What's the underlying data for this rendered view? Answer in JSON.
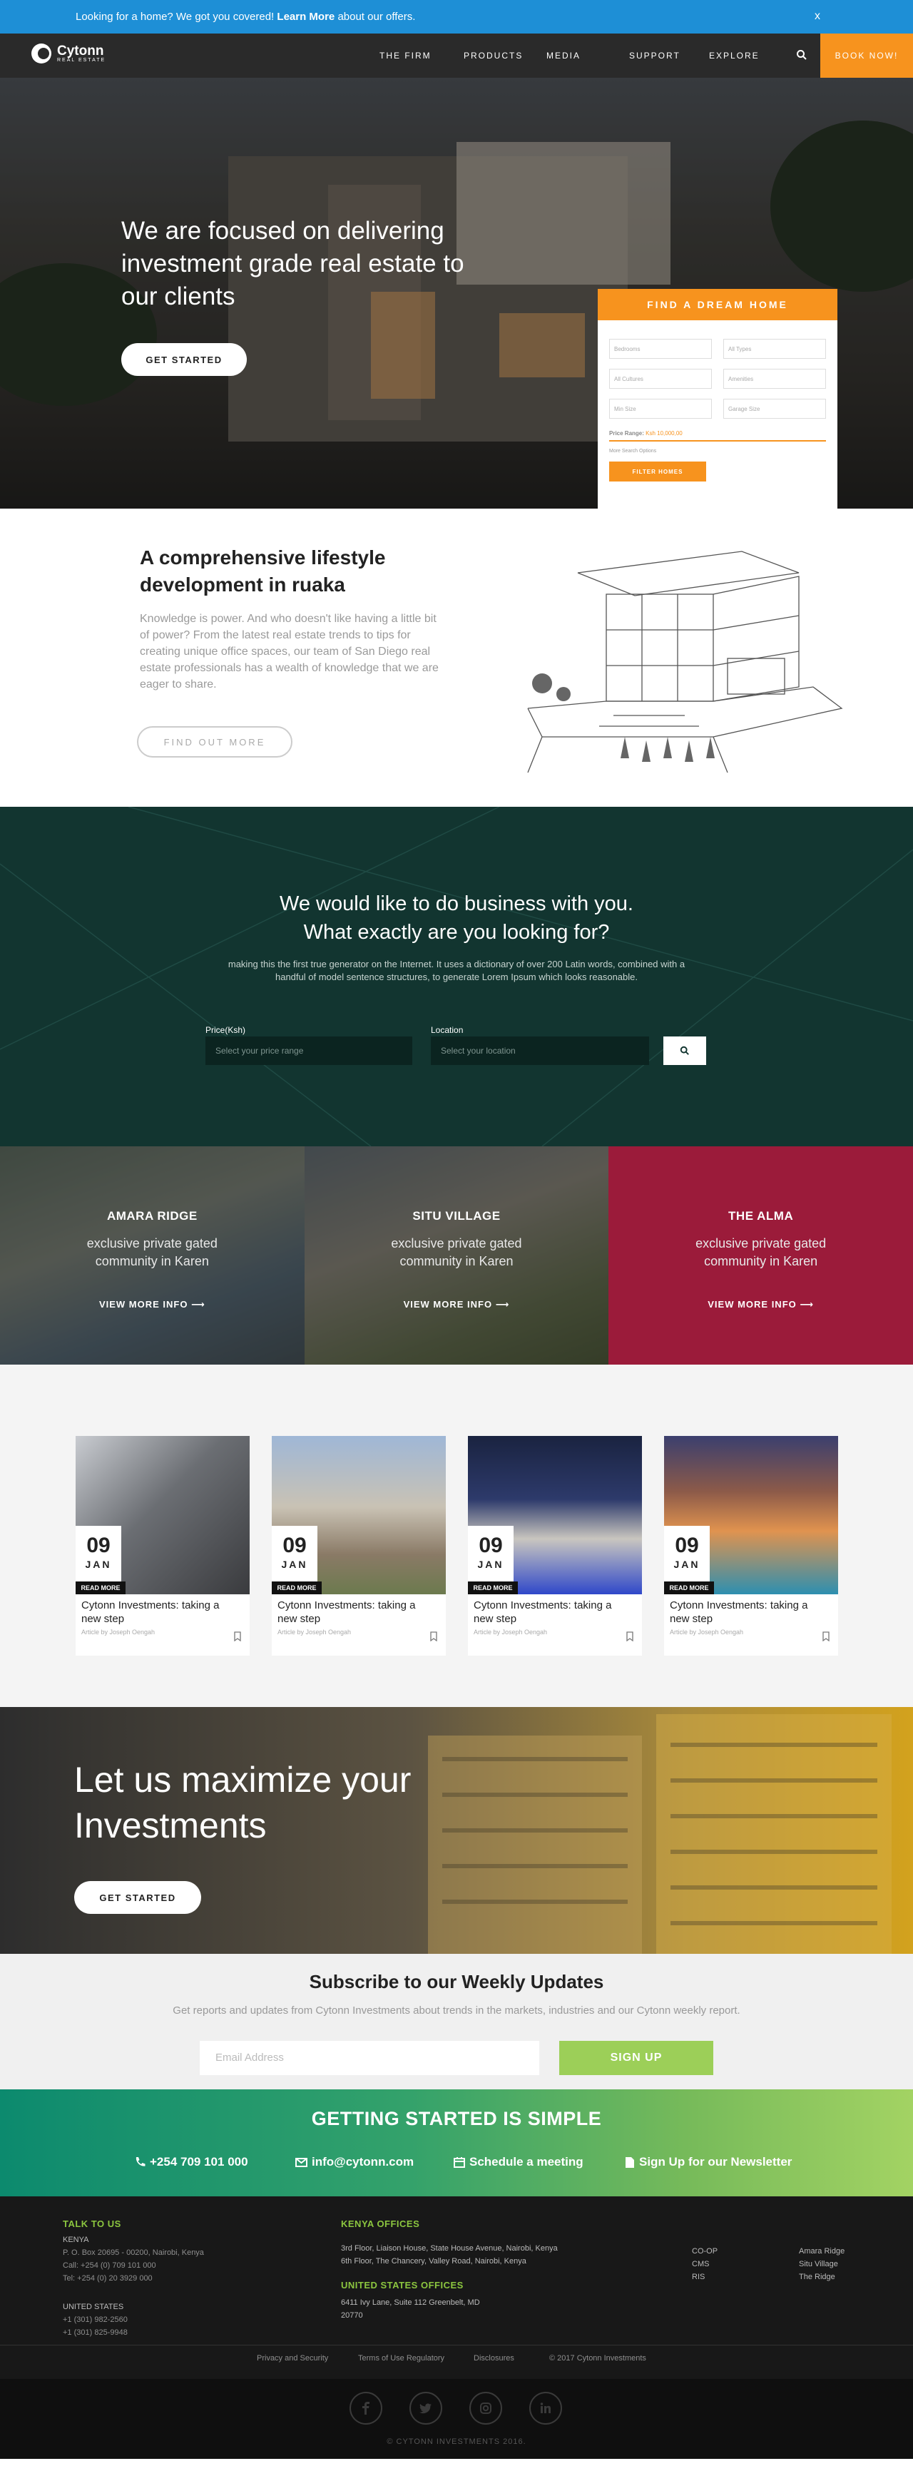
{
  "banner": {
    "text_before": "Looking for a home? We got you covered!",
    "link": "Learn More",
    "text_after": "about our offers.",
    "close": "x"
  },
  "brand": {
    "name": "Cytonn",
    "tagline": "REAL ESTATE"
  },
  "nav": {
    "items": [
      "THE FIRM",
      "PRODUCTS",
      "MEDIA",
      "SUPPORT",
      "EXPLORE"
    ],
    "book": "BOOK NOW!"
  },
  "hero": {
    "headline": "We are focused on delivering investment grade real estate to our clients",
    "cta": "GET STARTED"
  },
  "finder": {
    "title": "FIND A DREAM HOME",
    "fields": [
      "Bedrooms",
      "All Types",
      "All Cultures",
      "Amenities",
      "Min Size",
      "Garage Size"
    ],
    "range_label": "Price Range:",
    "range_value": "Ksh 10,000,00",
    "more": "More Search Options",
    "filter": "FILTER HOMES"
  },
  "lifestyle": {
    "title": "A comprehensive lifestyle development in ruaka",
    "body": "Knowledge is power. And who doesn't like having a little bit of power? From the latest real estate trends to tips for creating unique office spaces, our team of San Diego real estate professionals has a wealth of knowledge that we are eager to share.",
    "button": "FIND OUT MORE"
  },
  "business": {
    "title_line1": "We would like to do business with you.",
    "title_line2": "What exactly are you looking for?",
    "body": "making this the first true generator on the Internet. It uses a dictionary of over 200 Latin words, combined with a handful of model sentence structures, to generate Lorem Ipsum which looks reasonable.",
    "price_label": "Price(Ksh)",
    "price_placeholder": "Select your price range",
    "location_label": "Location",
    "location_placeholder": "Select your location"
  },
  "properties": [
    {
      "name": "AMARA RIDGE",
      "desc": "exclusive private gated community in Karen",
      "link": "VIEW MORE INFO"
    },
    {
      "name": "SITU VILLAGE",
      "desc": "exclusive private gated community in Karen",
      "link": "VIEW MORE INFO"
    },
    {
      "name": "THE ALMA",
      "desc": "exclusive private gated community in Karen",
      "link": "VIEW MORE INFO"
    }
  ],
  "articles": [
    {
      "day": "09",
      "month": "JAN",
      "read": "READ MORE",
      "title": "Cytonn Investments: taking a new step",
      "author": "Article by Joseph Oengah"
    },
    {
      "day": "09",
      "month": "JAN",
      "read": "READ MORE",
      "title": "Cytonn Investments: taking a new step",
      "author": "Article by Joseph Oengah"
    },
    {
      "day": "09",
      "month": "JAN",
      "read": "READ MORE",
      "title": "Cytonn Investments: taking a new step",
      "author": "Article by Joseph Oengah"
    },
    {
      "day": "09",
      "month": "JAN",
      "read": "READ MORE",
      "title": "Cytonn Investments: taking a new step",
      "author": "Article by Joseph Oengah"
    }
  ],
  "invest": {
    "title": "Let us maximize your Investments",
    "cta": "GET STARTED"
  },
  "subscribe": {
    "title": "Subscribe to our Weekly Updates",
    "body": "Get reports and updates from Cytonn Investments about trends in the markets, industries and our Cytonn weekly report.",
    "placeholder": "Email Address",
    "button": "SIGN UP"
  },
  "started": {
    "title": "GETTING STARTED IS SIMPLE",
    "phone": "+254 709 101 000",
    "email": "info@cytonn.com",
    "meeting": "Schedule a meeting",
    "newsletter": "Sign Up for our Newsletter"
  },
  "footer": {
    "talk_title": "TALK TO US",
    "kenya": "KENYA",
    "kenya_lines": [
      "P. O. Box 20695 - 00200, Nairobi, Kenya",
      "Call: +254 (0) 709 101 000",
      "Tel: +254 (0) 20 3929 000"
    ],
    "us": "UNITED STATES",
    "us_lines": [
      "+1 (301) 982-2560",
      "+1 (301) 825-9948"
    ],
    "kenya_offices_title": "KENYA OFFICES",
    "kenya_offices": [
      "3rd Floor, Liaison House, State House Avenue, Nairobi, Kenya",
      "6th Floor, The Chancery, Valley Road, Nairobi, Kenya"
    ],
    "us_offices_title": "UNITED STATES OFFICES",
    "us_offices": [
      "6411 Ivy Lane, Suite 112 Greenbelt, MD",
      "20770"
    ],
    "links_a": [
      "CO-OP",
      "CMS",
      "RIS"
    ],
    "links_b": [
      "Amara Ridge",
      "Situ Village",
      "The Ridge"
    ],
    "legal": [
      "Privacy and Security",
      "Terms of Use Regulatory",
      "Disclosures",
      "© 2017 Cytonn Investments"
    ],
    "copyright": "© CYTONN INVESTMENTS 2016."
  },
  "icons": {
    "search": "search-icon",
    "arrow": "arrow-right-icon",
    "phone": "phone-icon",
    "mail": "envelope-icon",
    "calendar": "calendar-icon",
    "doc": "document-icon",
    "bookmark": "bookmark-icon",
    "social": [
      "facebook-icon",
      "twitter-icon",
      "instagram-icon",
      "linkedin-icon"
    ]
  },
  "colors": {
    "accent": "#f7931e",
    "banner": "#1e8fd6",
    "green": "#8cc63f",
    "alma": "#9b1b3a",
    "dark_teal": "#123530"
  }
}
